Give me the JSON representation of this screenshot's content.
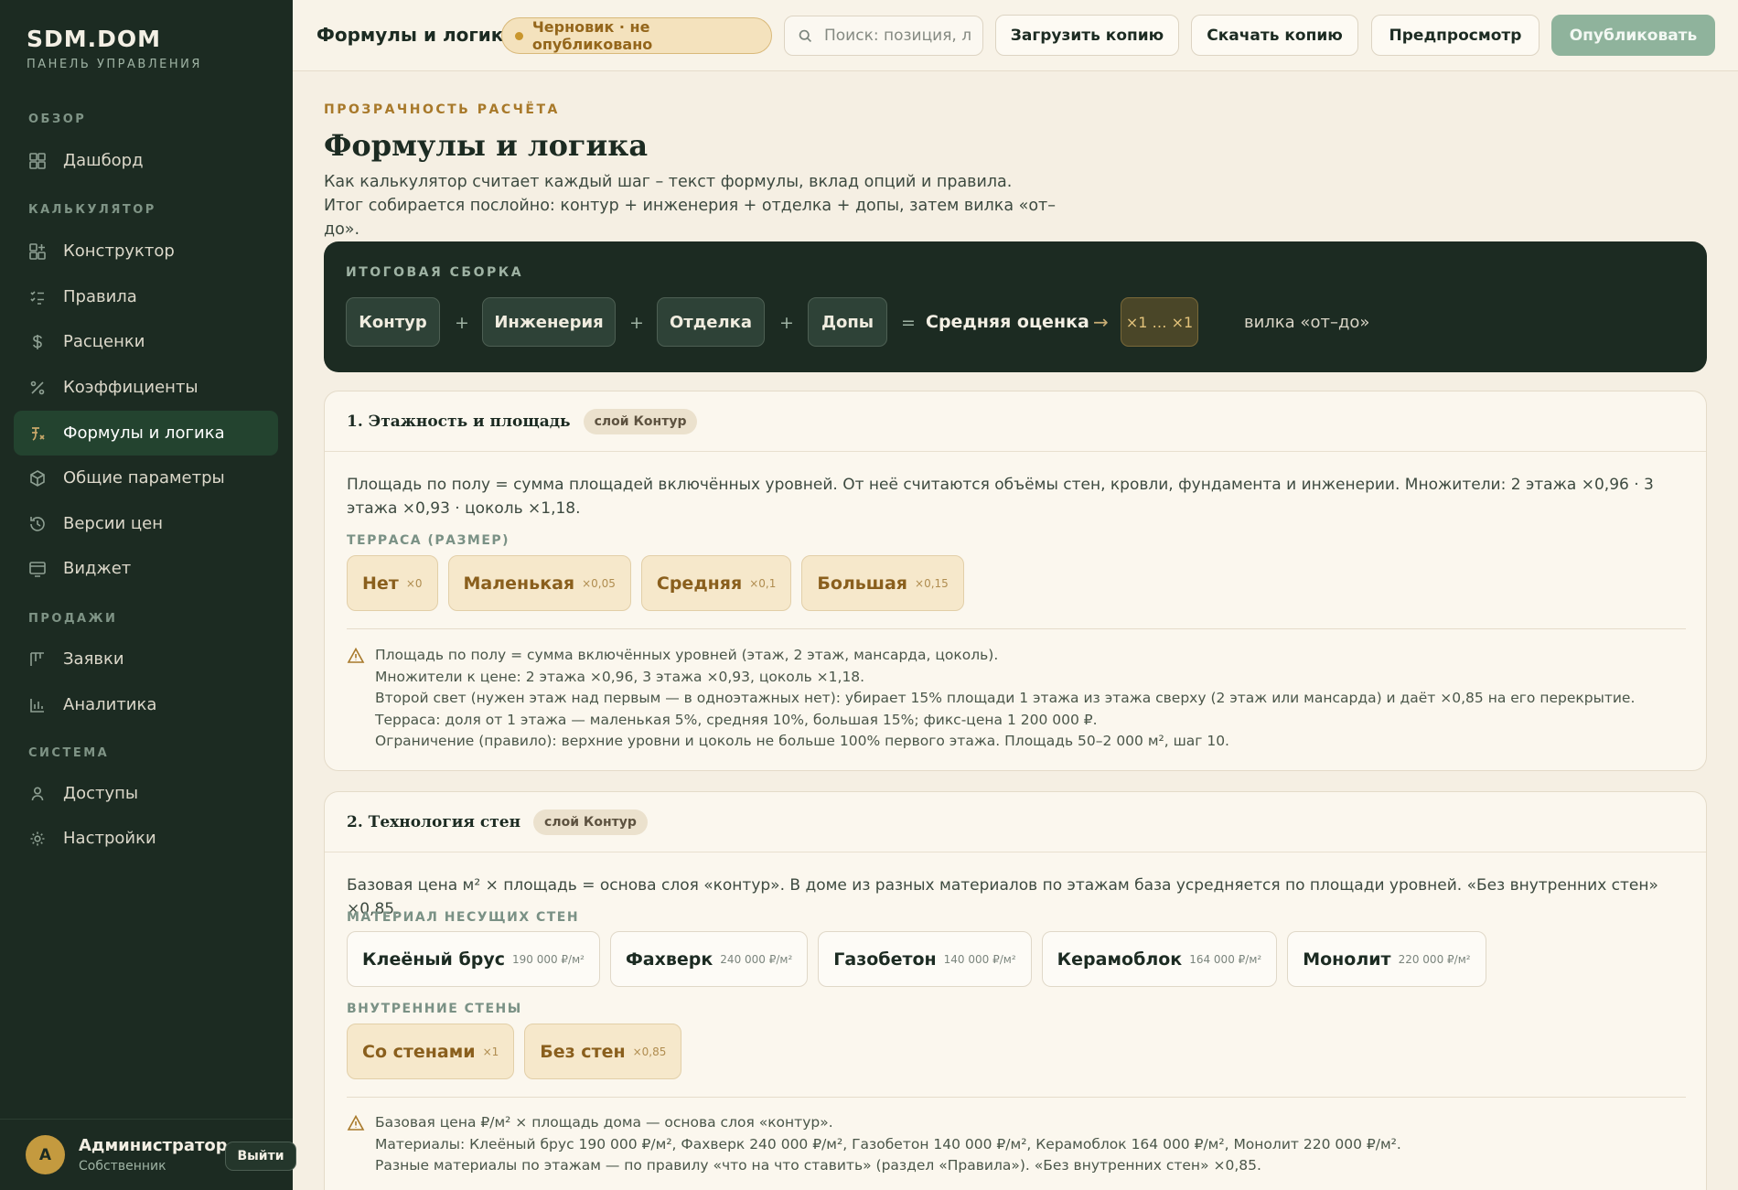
{
  "brand": {
    "name": "SDM.DOM",
    "subtitle": "ПАНЕЛЬ УПРАВЛЕНИЯ"
  },
  "sidebar": {
    "sections": [
      {
        "label": "ОБЗОР"
      },
      {
        "label": "КАЛЬКУЛЯТОР"
      },
      {
        "label": "ПРОДАЖИ"
      },
      {
        "label": "СИСТЕМА"
      }
    ],
    "items": [
      {
        "label": "Дашборд",
        "icon": "grid-icon"
      },
      {
        "label": "Конструктор",
        "icon": "blocks-icon"
      },
      {
        "label": "Правила",
        "icon": "list-check-icon"
      },
      {
        "label": "Расценки",
        "icon": "dollar-icon"
      },
      {
        "label": "Коэффициенты",
        "icon": "percent-icon"
      },
      {
        "label": "Формулы и логика",
        "icon": "function-icon",
        "active": true
      },
      {
        "label": "Общие параметры",
        "icon": "cube-icon"
      },
      {
        "label": "Версии цен",
        "icon": "history-icon"
      },
      {
        "label": "Виджет",
        "icon": "widget-icon"
      },
      {
        "label": "Заявки",
        "icon": "kanban-icon"
      },
      {
        "label": "Аналитика",
        "icon": "bar-chart-icon"
      },
      {
        "label": "Доступы",
        "icon": "user-icon"
      },
      {
        "label": "Настройки",
        "icon": "gear-icon"
      }
    ],
    "user": {
      "initial": "А",
      "name": "Администратор",
      "role": "Собственник",
      "logout": "Выйти"
    }
  },
  "topbar": {
    "title": "Формулы и логика",
    "status": "Черновик · не опубликовано",
    "search_placeholder": "Поиск: позиция, лист, раздел",
    "upload": "Загрузить копию",
    "download": "Скачать копию",
    "preview": "Предпросмотр",
    "publish": "Опубликовать"
  },
  "page": {
    "eyebrow": "ПРОЗРАЧНОСТЬ РАСЧЁТА",
    "title": "Формулы и логика",
    "description": "Как калькулятор считает каждый шаг – текст формулы, вклад опций и правила. Итог собирается послойно: контур + инженерия + отделка + допы, затем вилка «от–до»."
  },
  "formula": {
    "label": "ИТОГОВАЯ СБОРКА",
    "parts": [
      "Контур",
      "Инженерия",
      "Отделка",
      "Допы"
    ],
    "plus": "+",
    "equals": "=",
    "result": "Средняя оценка",
    "arrow": "→",
    "range": "×1 … ×1",
    "range_note": "вилка «от–до»"
  },
  "cards": [
    {
      "title": "1. Этажность и площадь",
      "layer": "слой Контур",
      "description": "Площадь по полу = сумма площадей включённых уровней. От неё считаются объёмы стен, кровли, фундамента и инженерии. Множители: 2 этажа ×0,96 · 3 этажа ×0,93 · цоколь ×1,18.",
      "groups": [
        {
          "label": "ТЕРРАСА (РАЗМЕР)",
          "options": [
            {
              "label": "Нет",
              "mult": "×0"
            },
            {
              "label": "Маленькая",
              "mult": "×0,05"
            },
            {
              "label": "Средняя",
              "mult": "×0,1"
            },
            {
              "label": "Большая",
              "mult": "×0,15"
            }
          ]
        }
      ],
      "notes": [
        "Площадь по полу = сумма включённых уровней (этаж, 2 этаж, мансарда, цоколь).",
        "Множители к цене: 2 этажа ×0,96, 3 этажа ×0,93, цоколь ×1,18.",
        "Второй свет (нужен этаж над первым — в одноэтажных нет): убирает 15% площади 1 этажа из этажа сверху (2 этаж или мансарда) и даёт ×0,85 на его перекрытие.",
        "Терраса: доля от 1 этажа — маленькая 5%, средняя 10%, большая 15%; фикс-цена 1 200 000 ₽.",
        "Ограничение (правило): верхние уровни и цоколь не больше 100% первого этажа. Площадь 50–2 000 м², шаг 10."
      ]
    },
    {
      "title": "2. Технология стен",
      "layer": "слой Контур",
      "description": "Базовая цена м² × площадь = основа слоя «контур». В доме из разных материалов по этажам база усредняется по площади уровней. «Без внутренних стен» ×0,85.",
      "groups": [
        {
          "label": "МАТЕРИАЛ НЕСУЩИХ СТЕН",
          "options": [
            {
              "label": "Клеёный брус",
              "mult": "190 000 ₽/м²"
            },
            {
              "label": "Фахверк",
              "mult": "240 000 ₽/м²"
            },
            {
              "label": "Газобетон",
              "mult": "140 000 ₽/м²"
            },
            {
              "label": "Керамоблок",
              "mult": "164 000 ₽/м²"
            },
            {
              "label": "Монолит",
              "mult": "220 000 ₽/м²"
            }
          ]
        },
        {
          "label": "ВНУТРЕННИЕ СТЕНЫ",
          "options": [
            {
              "label": "Со стенами",
              "mult": "×1"
            },
            {
              "label": "Без стен",
              "mult": "×0,85"
            }
          ]
        }
      ],
      "notes": [
        "Базовая цена ₽/м² × площадь дома — основа слоя «контур».",
        "Материалы: Клеёный брус 190 000 ₽/м², Фахверк 240 000 ₽/м², Газобетон 140 000 ₽/м², Керамоблок 164 000 ₽/м², Монолит 220 000 ₽/м².",
        "Разные материалы по этажам — по правилу «что на что ставить» (раздел «Правила»). «Без внутренних стен» ×0,85."
      ]
    }
  ],
  "colors": {
    "sidebar_bg": "#1c2b22",
    "active_nav": "#23432f",
    "accent_gold": "#a8792a",
    "page_bg": "#f5efe3",
    "publish_bg": "#8fb39c"
  }
}
